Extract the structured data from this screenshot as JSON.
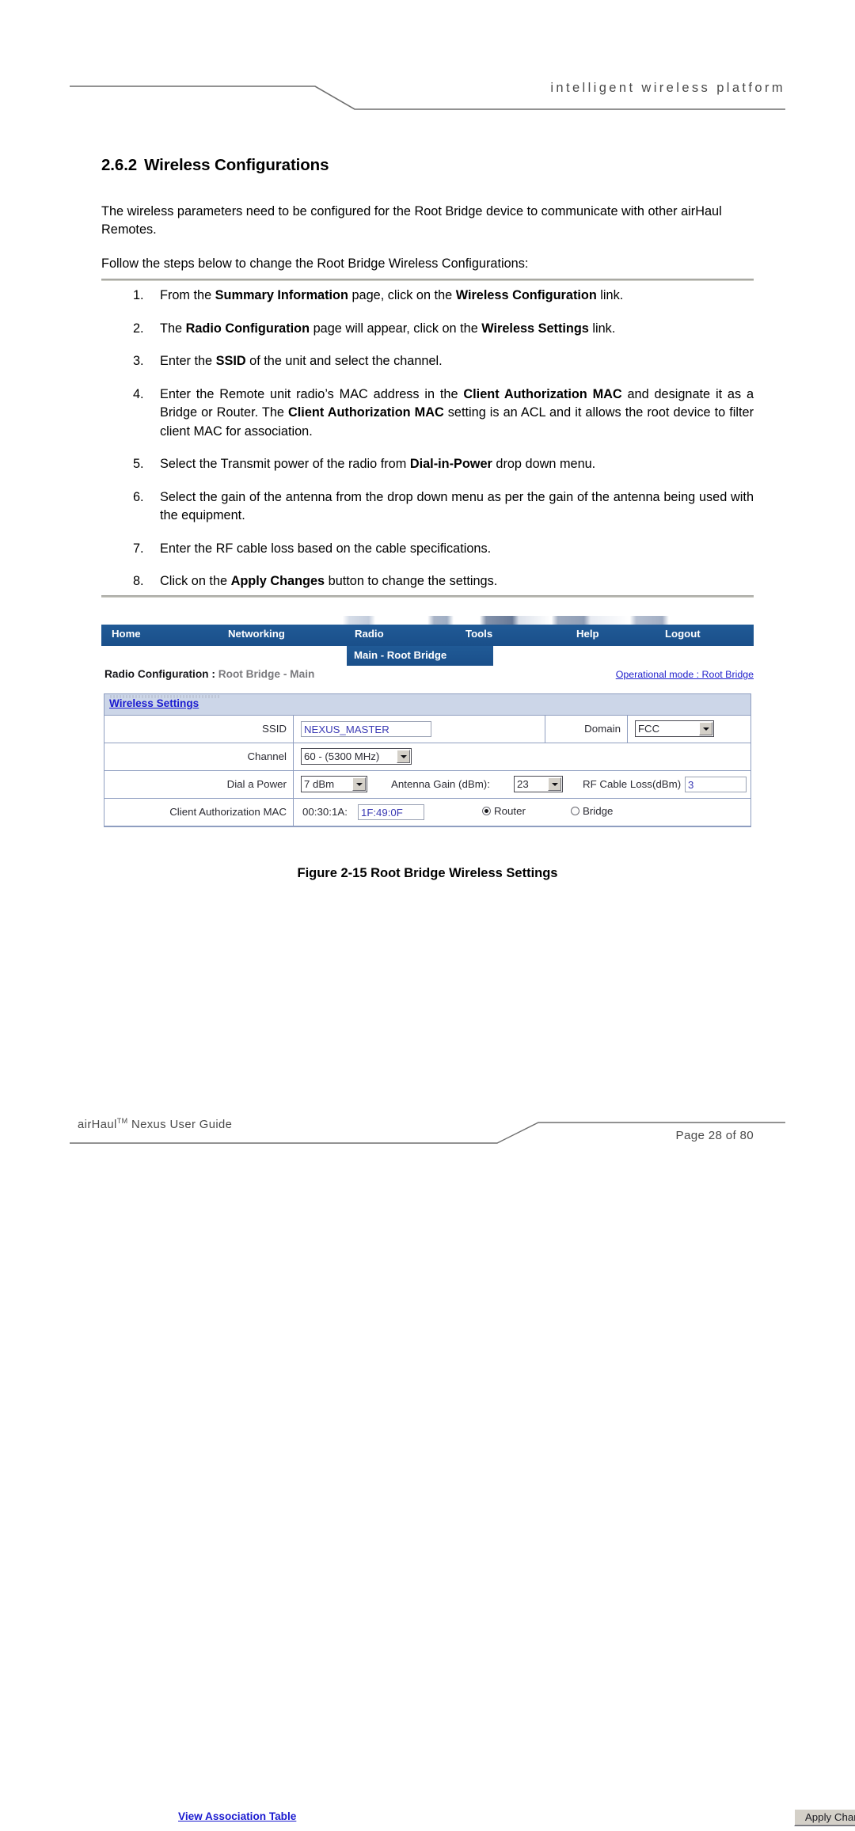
{
  "banner": {
    "tagline": "intelligent   wireless   platform"
  },
  "heading": {
    "number": "2.6.2",
    "title": "Wireless Configurations"
  },
  "intro": {
    "paragraph1": "The wireless parameters need to be configured for the Root Bridge device to communicate with other airHaul Remotes.",
    "paragraph2": "Follow the steps below to change the Root Bridge Wireless Configurations:"
  },
  "steps": [
    {
      "marker": "1.",
      "parts": [
        {
          "text": "From the ",
          "bold": false
        },
        {
          "text": "Summary Information",
          "bold": true
        },
        {
          "text": " page, click on the ",
          "bold": false
        },
        {
          "text": "Wireless Configuration",
          "bold": true
        },
        {
          "text": " link.",
          "bold": false
        }
      ]
    },
    {
      "marker": "2.",
      "parts": [
        {
          "text": "The ",
          "bold": false
        },
        {
          "text": "Radio Configuration",
          "bold": true
        },
        {
          "text": " page will appear, click on the ",
          "bold": false
        },
        {
          "text": "Wireless Settings",
          "bold": true
        },
        {
          "text": " link.",
          "bold": false
        }
      ]
    },
    {
      "marker": "3.",
      "parts": [
        {
          "text": "Enter the ",
          "bold": false
        },
        {
          "text": "SSID",
          "bold": true
        },
        {
          "text": " of the unit and select the channel.",
          "bold": false
        }
      ]
    },
    {
      "marker": "4.",
      "parts": [
        {
          "text": "Enter the Remote unit radio’s MAC address in the ",
          "bold": false
        },
        {
          "text": "Client Authorization MAC",
          "bold": true
        },
        {
          "text": " and designate it as a Bridge or Router. The ",
          "bold": false
        },
        {
          "text": "Client Authorization MAC",
          "bold": true
        },
        {
          "text": " setting is an ACL and it allows the root device to filter client MAC for association.",
          "bold": false
        }
      ]
    },
    {
      "marker": "5.",
      "parts": [
        {
          "text": "Select the Transmit power of the radio from ",
          "bold": false
        },
        {
          "text": "Dial-in-Power",
          "bold": true
        },
        {
          "text": " drop down menu.",
          "bold": false
        }
      ]
    },
    {
      "marker": "6.",
      "parts": [
        {
          "text": "Select the gain of the antenna from the drop down menu as per the gain of the antenna being used with the equipment.",
          "bold": false
        }
      ]
    },
    {
      "marker": "7.",
      "parts": [
        {
          "text": "Enter the RF cable loss based on the cable specifications.",
          "bold": false
        }
      ]
    },
    {
      "marker": "8.",
      "parts": [
        {
          "text": "Click on the ",
          "bold": false
        },
        {
          "text": "Apply Changes",
          "bold": true
        },
        {
          "text": " button to change the settings.",
          "bold": false
        }
      ]
    }
  ],
  "screenshot": {
    "nav": {
      "home": "Home",
      "networking": "Networking",
      "radio": "Radio",
      "tools": "Tools",
      "help": "Help",
      "logout": "Logout"
    },
    "submenu": {
      "main_root_bridge": "Main - Root Bridge"
    },
    "page_title": {
      "bold": "Radio Configuration : ",
      "gray": "Root Bridge - Main"
    },
    "operational_mode_link": "Operational mode : Root Bridge",
    "panel": {
      "title": "Wireless Settings",
      "ssid_label": "SSID",
      "ssid_value": "NEXUS_MASTER",
      "domain_label": "Domain",
      "domain_value": "FCC",
      "channel_label": "Channel",
      "channel_value": "60 - (5300 MHz)",
      "power_label": "Dial a Power",
      "power_value": "7 dBm",
      "antenna_gain_label": "Antenna Gain (dBm):",
      "antenna_gain_value": "23",
      "rf_cable_loss_label": "RF Cable Loss(dBm) :",
      "rf_cable_loss_value": "3",
      "mac_label": "Client Authorization MAC",
      "mac_prefix": "00:30:1A:",
      "mac_value": "1F:49:0F",
      "router_label": "Router",
      "bridge_label": "Bridge",
      "selected_mode": "Router",
      "view_association_table": "View Association Table",
      "apply_changes": "Apply Changes"
    },
    "colors": {
      "navbar": "#1c5490",
      "panel_header": "#ccd6e8",
      "link": "#1a1ad0",
      "border": "#8f9ec0"
    }
  },
  "figure": {
    "caption": "Figure 2-15 Root Bridge Wireless Settings"
  },
  "footer": {
    "guide_prefix": "airHaul",
    "guide_tm": "TM",
    "guide_suffix": " Nexus User Guide",
    "page": "Page 28 of 80"
  }
}
